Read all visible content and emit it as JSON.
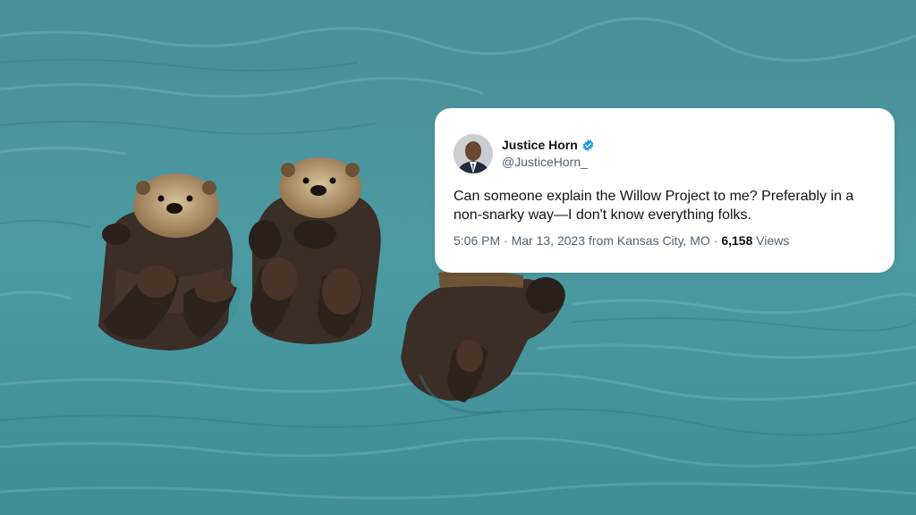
{
  "background": {
    "water_color": "#4f9aa0",
    "otters_count": 3
  },
  "tweet": {
    "author_name": "Justice Horn",
    "author_handle": "@JusticeHorn_",
    "verified_icon": "verified-badge-icon",
    "verified_color": "#1d9bf0",
    "text": "Can someone explain the Willow Project to me? Preferably in a non-snarky way—I don't know everything folks.",
    "time": "5:06 PM",
    "date": "Mar 13, 2023",
    "location_prefix": "from",
    "location": "Kansas City, MO",
    "separator": "·",
    "views_count": "6,158",
    "views_label": "Views"
  }
}
